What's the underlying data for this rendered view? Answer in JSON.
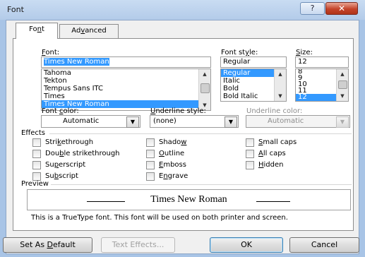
{
  "window": {
    "title": "Font",
    "help_glyph": "?",
    "close_glyph": "✕"
  },
  "tabs": [
    {
      "label": "Font",
      "active": true
    },
    {
      "label": "Advanced",
      "active": false
    }
  ],
  "font": {
    "label": "Font:",
    "value": "Times New Roman",
    "items": [
      "Tahoma",
      "Tekton",
      "Tempus Sans ITC",
      "Times",
      "Times New Roman"
    ],
    "selected": "Times New Roman"
  },
  "style": {
    "label": "Font style:",
    "value": "Regular",
    "items": [
      "Regular",
      "Italic",
      "Bold",
      "Bold Italic"
    ],
    "selected": "Regular"
  },
  "size": {
    "label": "Size:",
    "value": "12",
    "items": [
      "8",
      "9",
      "10",
      "11",
      "12"
    ],
    "selected": "12"
  },
  "font_color": {
    "label": "Font color:",
    "value": "Automatic"
  },
  "underline_style": {
    "label": "Underline style:",
    "value": "(none)"
  },
  "underline_color": {
    "label": "Underline color:",
    "value": "Automatic"
  },
  "effects": {
    "label": "Effects",
    "items": [
      "Strikethrough",
      "Double strikethrough",
      "Superscript",
      "Subscript",
      "Shadow",
      "Outline",
      "Emboss",
      "Engrave",
      "Small caps",
      "All caps",
      "Hidden"
    ]
  },
  "preview": {
    "label": "Preview",
    "sample": "Times New Roman",
    "note": "This is a TrueType font. This font will be used on both printer and screen."
  },
  "buttons": {
    "set_default": "Set As Default",
    "text_effects": "Text Effects...",
    "ok": "OK",
    "cancel": "Cancel"
  },
  "colors": {
    "selection": "#3399ff",
    "titlebar": "#b3cbe9",
    "close": "#c4432a"
  }
}
